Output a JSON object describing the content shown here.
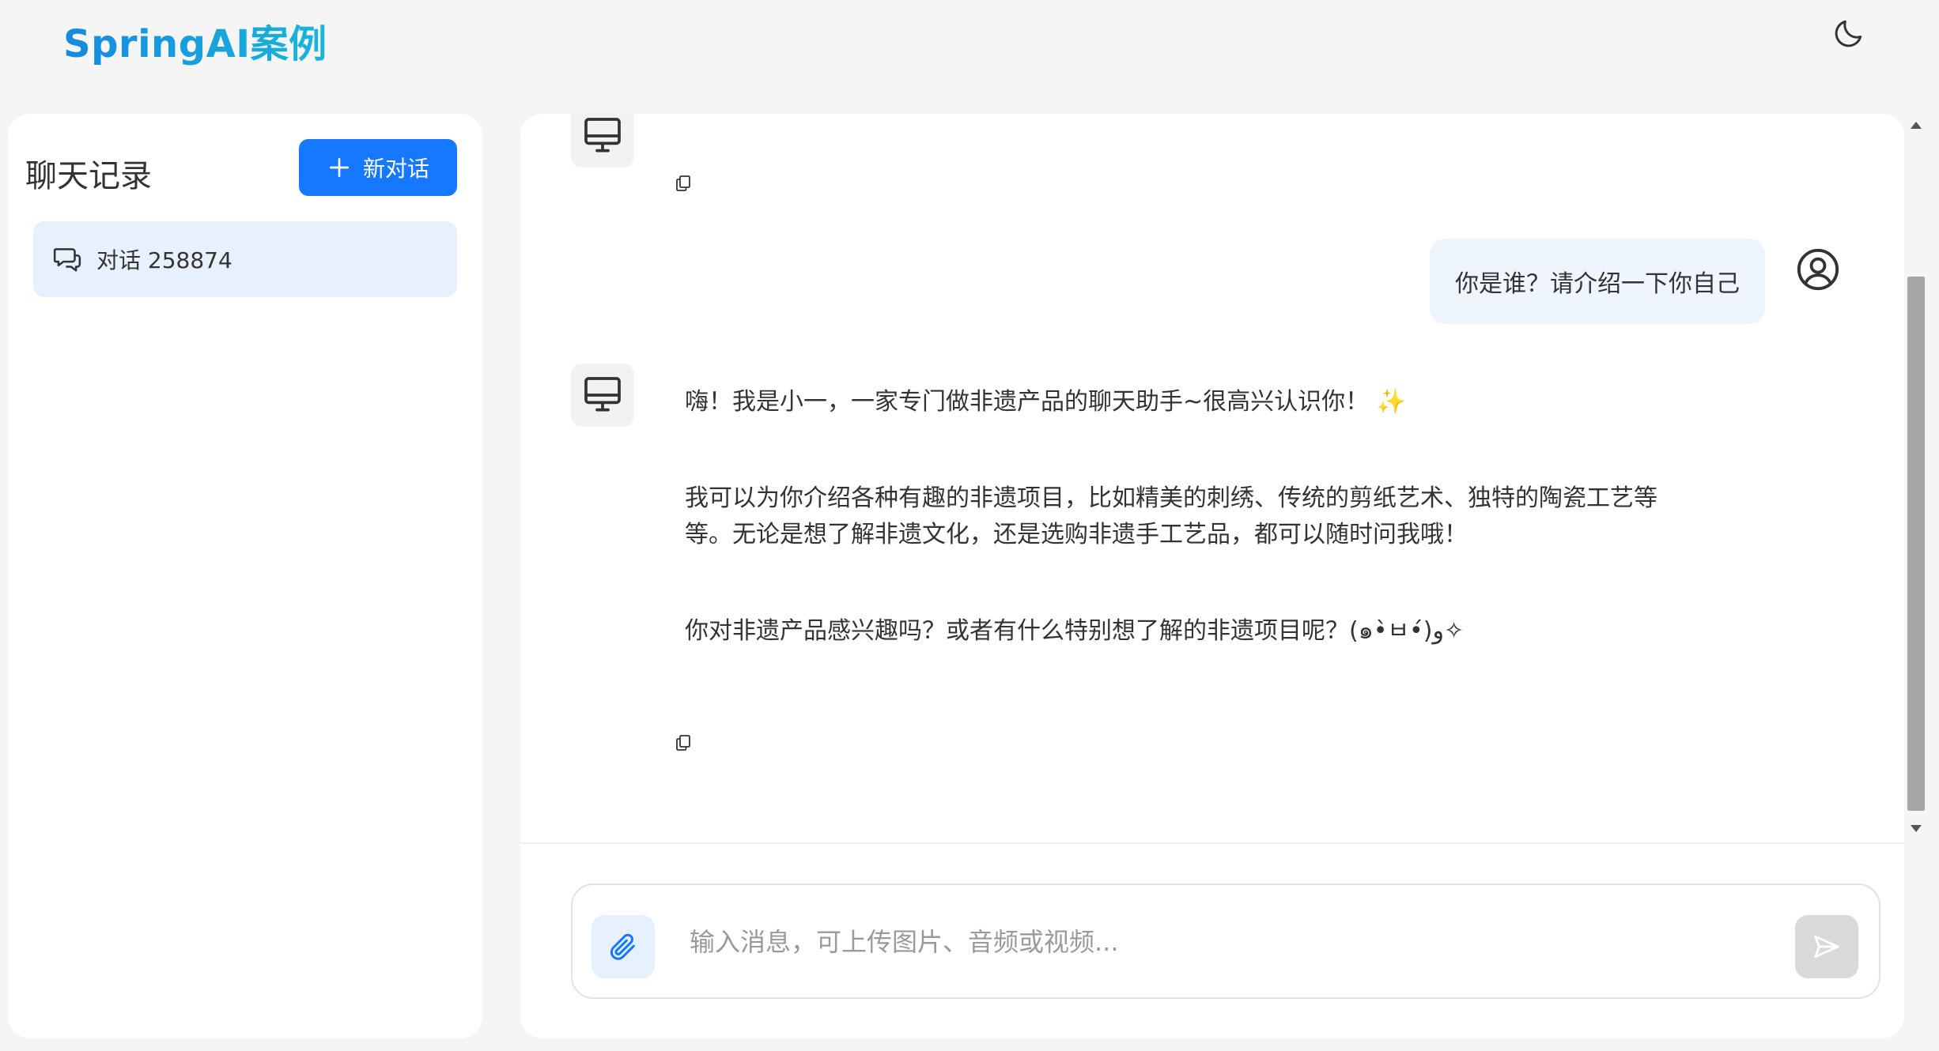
{
  "app": {
    "brand": "SpringAI案例",
    "theme_icon": "moon-icon"
  },
  "sidebar": {
    "title": "聊天记录",
    "new_chat_label": "新对话",
    "conversations": [
      {
        "label": "对话 258874",
        "icon": "chat-bubbles-icon",
        "active": true
      }
    ]
  },
  "chat": {
    "messages": [
      {
        "role": "assistant",
        "text": ""
      },
      {
        "role": "user",
        "text": "你是谁？请介绍一下你自己"
      },
      {
        "role": "assistant",
        "paragraphs": [
          "嗨！我是小一，一家专门做非遗产品的聊天助手~很高兴认识你！ ✨",
          "我可以为你介绍各种有趣的非遗项目，比如精美的刺绣、传统的剪纸艺术、独特的陶瓷工艺等等。无论是想了解非遗文化，还是选购非遗手工艺品，都可以随时问我哦！",
          "你对非遗产品感兴趣吗？或者有什么特别想了解的非遗项目呢？(๑•̀ㅂ•́)و✧"
        ]
      }
    ],
    "input": {
      "placeholder": "输入消息，可上传图片、音频或视频...",
      "value": ""
    }
  },
  "colors": {
    "primary": "#1677ff",
    "active_item_bg": "#e6f1fd",
    "user_bubble_bg": "#eef5fd",
    "send_disabled": "#d9d9d9"
  }
}
